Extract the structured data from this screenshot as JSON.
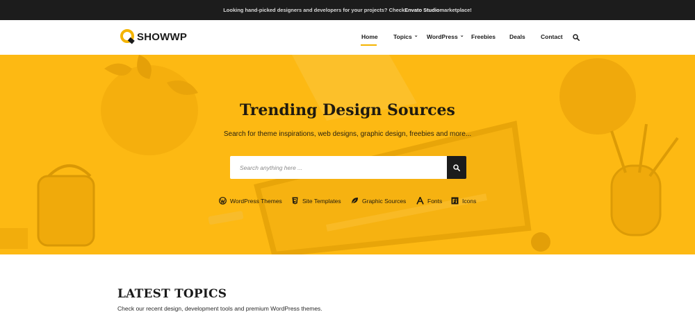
{
  "topbar": {
    "text_before": "Looking hand-picked designers and developers for your projects? Check ",
    "text_strong": "Envato Studio",
    "text_after": " marketplace!"
  },
  "brand": {
    "name": "SHOWWP",
    "accent": "#f4b400"
  },
  "nav": {
    "home": "Home",
    "topics": "Topics",
    "wordpress": "WordPress",
    "freebies": "Freebies",
    "deals": "Deals",
    "contact": "Contact",
    "active": "Home"
  },
  "hero": {
    "title": "Trending Design Sources",
    "subtitle": "Search for theme inspirations, web designs, graphic design, freebies and more...",
    "search_placeholder": "Search anything here ...",
    "background": "#fdb913"
  },
  "categories": [
    {
      "label": "WordPress Themes",
      "icon": "wordpress-icon"
    },
    {
      "label": "Site Templates",
      "icon": "html5-icon"
    },
    {
      "label": "Graphic Sources",
      "icon": "leaf-icon"
    },
    {
      "label": "Fonts",
      "icon": "font-icon"
    },
    {
      "label": "Icons",
      "icon": "fonticons-icon"
    }
  ],
  "latest": {
    "title": "LATEST TOPICS",
    "subtitle": "Check our recent design, development tools and premium WordPress themes."
  }
}
